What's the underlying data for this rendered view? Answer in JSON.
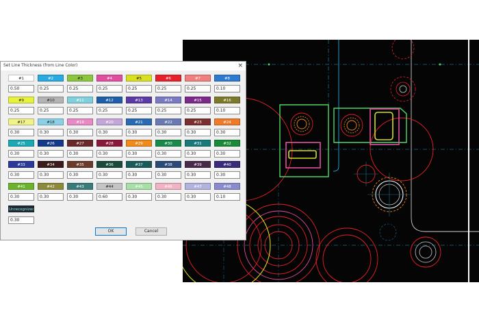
{
  "dialog": {
    "title": "Set Line Thickness (from Line Color)",
    "close_glyph": "×",
    "ok_label": "OK",
    "cancel_label": "Cancel"
  },
  "colors": [
    {
      "label": "#1",
      "bg": "#ffffff",
      "fg": "#222222",
      "value": "0.50"
    },
    {
      "label": "#2",
      "bg": "#29abe2",
      "fg": "#ffffff",
      "value": "0.25"
    },
    {
      "label": "#3",
      "bg": "#8cc63f",
      "fg": "#222222",
      "value": "0.25"
    },
    {
      "label": "#4",
      "bg": "#e24fa0",
      "fg": "#ffffff",
      "value": "0.25"
    },
    {
      "label": "#5",
      "bg": "#d9e021",
      "fg": "#222222",
      "value": "0.25"
    },
    {
      "label": "#6",
      "bg": "#e8202a",
      "fg": "#ffffff",
      "value": "0.25"
    },
    {
      "label": "#7",
      "bg": "#f08080",
      "fg": "#ffffff",
      "value": "0.25"
    },
    {
      "label": "#8",
      "bg": "#2e7ad1",
      "fg": "#ffffff",
      "value": "0.10"
    },
    {
      "label": "#9",
      "bg": "#e6f23c",
      "fg": "#222222",
      "value": "0.25"
    },
    {
      "label": "#10",
      "bg": "#b3b3b3",
      "fg": "#222222",
      "value": "0.25"
    },
    {
      "label": "#11",
      "bg": "#7fcfdc",
      "fg": "#ffffff",
      "value": "0.25"
    },
    {
      "label": "#12",
      "bg": "#1f5fa8",
      "fg": "#ffffff",
      "value": "0.25"
    },
    {
      "label": "#13",
      "bg": "#5b3aa6",
      "fg": "#ffffff",
      "value": "0.25"
    },
    {
      "label": "#14",
      "bg": "#7a7ac4",
      "fg": "#ffffff",
      "value": "0.25"
    },
    {
      "label": "#15",
      "bg": "#7b2a8a",
      "fg": "#ffffff",
      "value": "0.25"
    },
    {
      "label": "#16",
      "bg": "#7a7a2a",
      "fg": "#ffffff",
      "value": "0.10"
    },
    {
      "label": "#17",
      "bg": "#f2f28a",
      "fg": "#222222",
      "value": "0.30"
    },
    {
      "label": "#18",
      "bg": "#8ad1e8",
      "fg": "#222222",
      "value": "0.30"
    },
    {
      "label": "#19",
      "bg": "#e88ac4",
      "fg": "#ffffff",
      "value": "0.30"
    },
    {
      "label": "#20",
      "bg": "#c4a6d9",
      "fg": "#ffffff",
      "value": "0.30"
    },
    {
      "label": "#21",
      "bg": "#2a6ab3",
      "fg": "#ffffff",
      "value": "0.30"
    },
    {
      "label": "#22",
      "bg": "#6a7ab3",
      "fg": "#ffffff",
      "value": "0.30"
    },
    {
      "label": "#23",
      "bg": "#7a3030",
      "fg": "#ffffff",
      "value": "0.30"
    },
    {
      "label": "#24",
      "bg": "#f07a2a",
      "fg": "#ffffff",
      "value": "0.30"
    },
    {
      "label": "#25",
      "bg": "#1aa8b3",
      "fg": "#ffffff",
      "value": "0.30"
    },
    {
      "label": "#26",
      "bg": "#163a8a",
      "fg": "#ffffff",
      "value": "0.30"
    },
    {
      "label": "#27",
      "bg": "#6a2a2a",
      "fg": "#ffffff",
      "value": "0.30"
    },
    {
      "label": "#28",
      "bg": "#8a1a3a",
      "fg": "#ffffff",
      "value": "0.30"
    },
    {
      "label": "#29",
      "bg": "#f08a1a",
      "fg": "#ffffff",
      "value": "0.30"
    },
    {
      "label": "#30",
      "bg": "#1a8a4a",
      "fg": "#ffffff",
      "value": "0.30"
    },
    {
      "label": "#31",
      "bg": "#1a7a7a",
      "fg": "#ffffff",
      "value": "0.30"
    },
    {
      "label": "#32",
      "bg": "#1a8a3a",
      "fg": "#ffffff",
      "value": "0.30"
    },
    {
      "label": "#33",
      "bg": "#2a3a9a",
      "fg": "#ffffff",
      "value": "0.30"
    },
    {
      "label": "#34",
      "bg": "#3a1a1a",
      "fg": "#ffffff",
      "value": "0.30"
    },
    {
      "label": "#35",
      "bg": "#6a3a2a",
      "fg": "#ffffff",
      "value": "0.30"
    },
    {
      "label": "#36",
      "bg": "#1a4a3a",
      "fg": "#ffffff",
      "value": "0.30"
    },
    {
      "label": "#37",
      "bg": "#1a5a5a",
      "fg": "#ffffff",
      "value": "0.30"
    },
    {
      "label": "#38",
      "bg": "#2a4a7a",
      "fg": "#ffffff",
      "value": "0.30"
    },
    {
      "label": "#39",
      "bg": "#4a2a4a",
      "fg": "#ffffff",
      "value": "0.30"
    },
    {
      "label": "#40",
      "bg": "#3a2a7a",
      "fg": "#ffffff",
      "value": "0.30"
    },
    {
      "label": "#41",
      "bg": "#6ab32a",
      "fg": "#ffffff",
      "value": "0.30"
    },
    {
      "label": "#42",
      "bg": "#8a8a3a",
      "fg": "#ffffff",
      "value": "0.30"
    },
    {
      "label": "#43",
      "bg": "#3a7a7a",
      "fg": "#ffffff",
      "value": "0.30"
    },
    {
      "label": "#44",
      "bg": "#c4c4c4",
      "fg": "#222222",
      "value": "0.60"
    },
    {
      "label": "#45",
      "bg": "#a6e0a6",
      "fg": "#ffffff",
      "value": "0.30"
    },
    {
      "label": "#46",
      "bg": "#f2b3c4",
      "fg": "#ffffff",
      "value": "0.30"
    },
    {
      "label": "#47",
      "bg": "#b3b3e0",
      "fg": "#ffffff",
      "value": "0.30"
    },
    {
      "label": "#48",
      "bg": "#8a8acf",
      "fg": "#ffffff",
      "value": "0.10"
    }
  ],
  "unrecognized": {
    "label": "Unrecognized Col",
    "bg": "#1e2a35",
    "fg": "#8fe3d0",
    "value": "0.30"
  },
  "canvas": {
    "background": "#050505",
    "accents": [
      "#e8202a",
      "#4cd964",
      "#e24fa0",
      "#d9e021",
      "#f08a1a",
      "#29abe2",
      "#ffffff"
    ]
  }
}
